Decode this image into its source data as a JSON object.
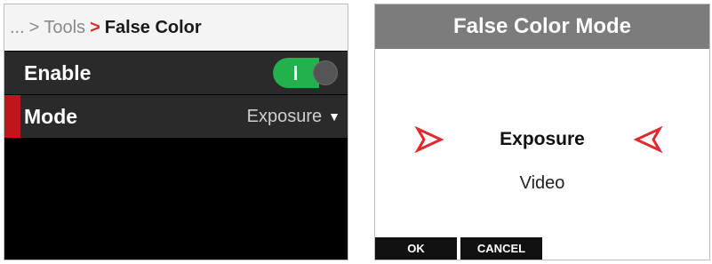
{
  "menu": {
    "breadcrumb": {
      "ellipsis": "...",
      "separator": ">",
      "parent": "Tools",
      "current": "False Color"
    },
    "rows": [
      {
        "label": "Enable",
        "control": "toggle",
        "toggle_on": true
      },
      {
        "label": "Mode",
        "value": "Exposure",
        "selected": true
      }
    ],
    "colors": {
      "accent_red": "#c2141c",
      "toggle_green": "#22b14c"
    }
  },
  "dialog": {
    "title": "False Color Mode",
    "selected_option": "Exposure",
    "other_option": "Video",
    "buttons": {
      "ok": "OK",
      "cancel": "CANCEL"
    },
    "colors": {
      "arrow_red": "#e0282f",
      "title_bar": "#7c7c7c"
    }
  },
  "icons": {
    "enable_toggle": "toggle-switch-icon",
    "mode_dropdown": "chevron-down-icon",
    "picker_prev": "triangle-right-outline-icon",
    "picker_next": "triangle-left-outline-icon"
  }
}
